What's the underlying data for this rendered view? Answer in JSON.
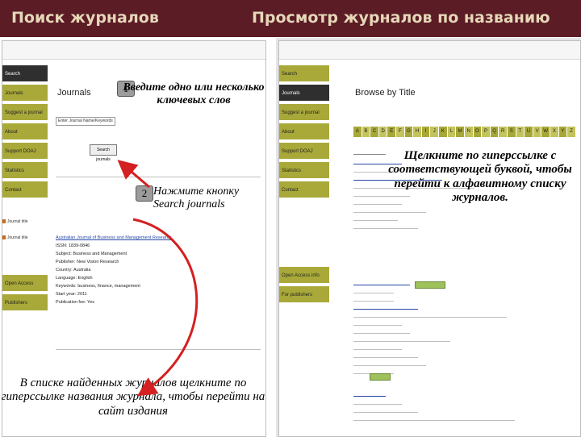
{
  "header": {
    "left_title": "Поиск журналов",
    "right_title": "Просмотр журналов по названию"
  },
  "left_screen": {
    "heading": "Journals",
    "search_placeholder": "Enter Journal Name/Keywords",
    "search_button": "Search journals",
    "sidebar": [
      "Search",
      "Journals",
      "Suggest a journal",
      "About",
      "Support DOAJ",
      "Statistics",
      "Contact"
    ],
    "result": {
      "title": "Australian Journal of Business and Management Research",
      "issn": "ISSN: 1839-0846",
      "subject": "Subject: Business and Management",
      "publisher": "Publisher: New Vision Research",
      "country": "Country: Australia",
      "language": "Language: English",
      "keywords": "Keywords: business, finance, management",
      "start_year": "Start year: 2011",
      "publication_fee": "Publication fee: Yes"
    },
    "side_logos": [
      "Journal title",
      "Journal title",
      "Open Access",
      "Publishers"
    ]
  },
  "right_screen": {
    "heading": "Browse by Title",
    "alphabet": [
      "A",
      "B",
      "C",
      "D",
      "E",
      "F",
      "G",
      "H",
      "I",
      "J",
      "K",
      "L",
      "M",
      "N",
      "O",
      "P",
      "Q",
      "R",
      "S",
      "T",
      "U",
      "V",
      "W",
      "X",
      "Y",
      "Z"
    ],
    "sidebar": [
      "Search",
      "Journals",
      "Suggest a journal",
      "About",
      "Support DOAJ",
      "Statistics",
      "Contact",
      "Open Access info",
      "For publishers"
    ]
  },
  "annotations": {
    "step1_number": "1",
    "step1_text": "Введите одно или несколько ключевых слов",
    "step2_number": "2",
    "step2_text": "Нажмите кнопку Search journals",
    "step3_text": "В списке найденных журналов щелкните по гиперссылке названия журнала, чтобы перейти на сайт издания",
    "step4_text": "Щелкните по гиперссылке с соответствующей буквой, чтобы перейти к алфавитному списку журналов."
  },
  "colors": {
    "header_bg": "#5b1c26",
    "header_text": "#e6d7b8",
    "sidebar_olive": "#a9a93a",
    "arrow_red": "#d42020"
  }
}
